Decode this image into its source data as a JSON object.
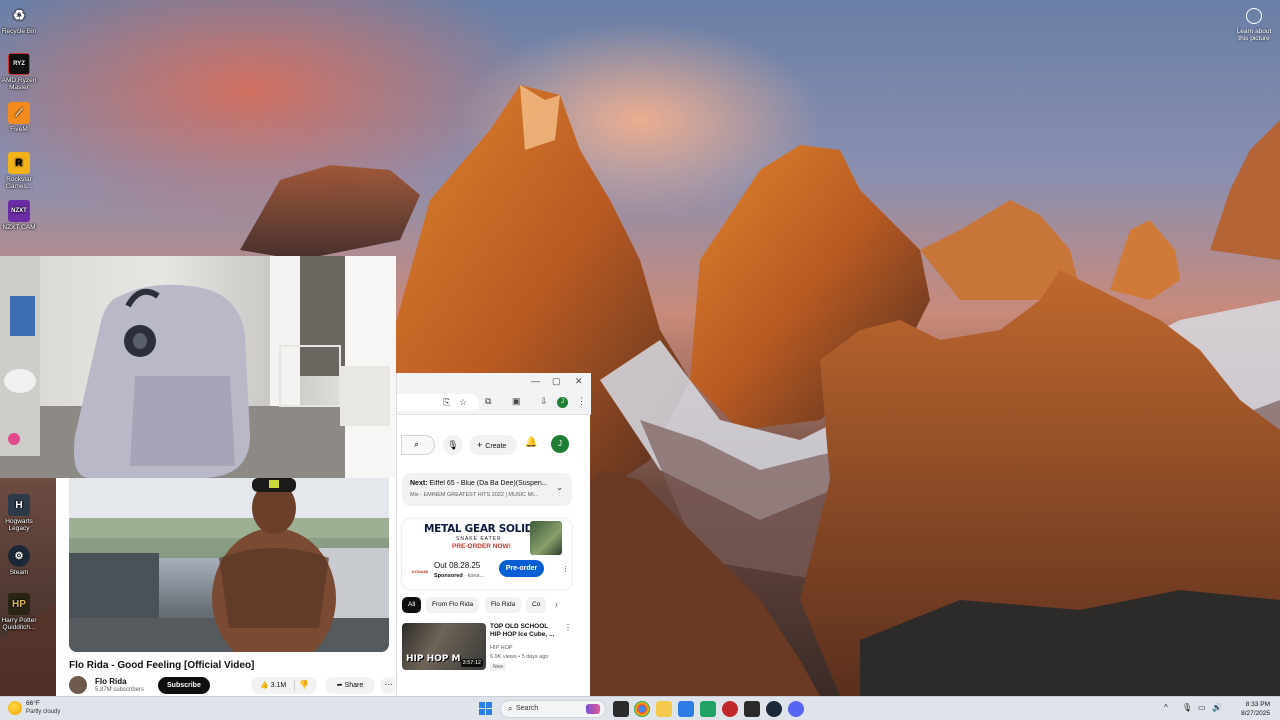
{
  "desktop": {
    "icons": [
      {
        "label": "Recycle Bin",
        "icon": "recycle-bin-icon"
      },
      {
        "label": "AMD Ryzen Master",
        "icon": "amd-ryzen-master-icon"
      },
      {
        "label": "FiveM",
        "icon": "fivem-icon"
      },
      {
        "label": "Rockstar Games...",
        "icon": "rockstar-games-icon"
      },
      {
        "label": "NZXT CAM",
        "icon": "nzxt-cam-icon"
      },
      {
        "label": "Hogwarts Legacy",
        "icon": "hogwarts-legacy-icon"
      },
      {
        "label": "Steam",
        "icon": "steam-icon"
      },
      {
        "label": "Harry Potter Quidditch...",
        "icon": "harry-potter-quidditch-icon"
      }
    ],
    "learn_about": "Learn about this picture"
  },
  "youtube_player": {
    "video_title": "Flo Rida - Good Feeling [Official Video]",
    "channel_name": "Flo Rida",
    "subscribers": "5.87M subscribers",
    "subscribe_label": "Subscribe",
    "likes": "3.1M",
    "share_label": "Share",
    "more_glyph": "⋯"
  },
  "youtube_header": {
    "create_label": "Create",
    "avatar_letter": "J"
  },
  "up_next": {
    "prefix": "Next:",
    "title": "Eiffel 65 - Blue (Da Ba Dee)(Suspen...",
    "subtitle": "Mix - EMINEM GREATEST HITS 2022 | MUSIC MI..."
  },
  "ad": {
    "title_main": "METAL GEAR SOLID",
    "title_delta": "Δ",
    "subtitle": "SNAKE EATER",
    "banner_cta": "PRE-ORDER NOW!",
    "logo": "KONAMI",
    "date": "Out 08.28.25",
    "sponsored": "Sponsored",
    "advertiser": "kona...",
    "cta": "Pre-order"
  },
  "chips": [
    "All",
    "From Flo Rida",
    "Flo Rida",
    "Co"
  ],
  "recommendation": {
    "title": "TOP OLD SCHOOL HIP HOP Ice Cube, ...",
    "channel": "HIP HOP",
    "meta": "6.9K views • 5 days ago",
    "badge": "New",
    "duration": "3:57:12",
    "thumb_text": "HIP HOP M"
  },
  "taskbar": {
    "weather_temp": "66°F",
    "weather_cond": "Partly cloudy",
    "search_label": "Search",
    "time": "8:33 PM",
    "date": "8/27/2025"
  },
  "colors": {
    "youtube_blue": "#065fd4",
    "avatar_green": "#1e7e34"
  }
}
